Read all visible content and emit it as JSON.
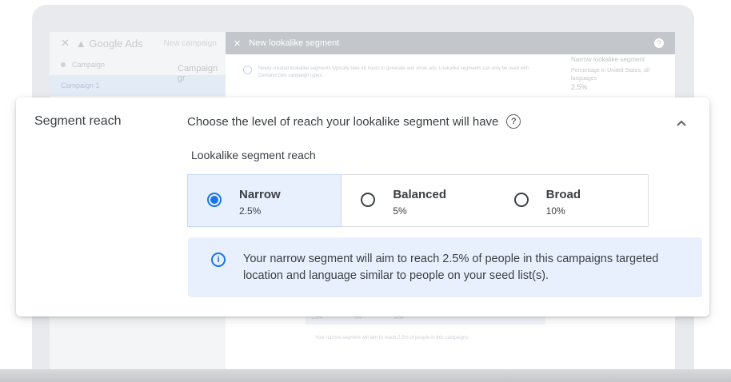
{
  "background": {
    "app_name": "Google Ads",
    "new_campaign": "New campaign",
    "sidebar": {
      "campaign_label": "Campaign",
      "campaign_item": "Campaign 1",
      "mid_label": "Campaign gr"
    },
    "panel": {
      "title": "New lookalike segment",
      "notice": "Newly created lookalike segments typically take 48 hours to generate and show ads. Lookalike segments can only be used with Demand Gen campaign types.",
      "side_title": "Narrow lookalike segment",
      "side_desc": "Percentage in United States, all languages",
      "side_value": "2.5%",
      "bottom_opt1": "2.5%",
      "bottom_opt2": "5%",
      "bottom_opt3": "10%",
      "bottom_msg": "Your narrow segment will aim to reach 2.5% of people in this campaigns"
    }
  },
  "card": {
    "section_title": "Segment reach",
    "description": "Choose the level of reach your lookalike segment will have",
    "subheading": "Lookalike segment reach",
    "options": [
      {
        "label": "Narrow",
        "value": "2.5%",
        "selected": true
      },
      {
        "label": "Balanced",
        "value": "5%",
        "selected": false
      },
      {
        "label": "Broad",
        "value": "10%",
        "selected": false
      }
    ],
    "info_text": "Your narrow segment will aim to reach 2.5% of people in this campaigns targeted location and language similar to people on your seed list(s)."
  },
  "colors": {
    "accent": "#1a73e8",
    "selected_bg": "#e8f0fe"
  },
  "icons": {
    "help": "help-circle-icon",
    "collapse": "chevron-up-icon",
    "info": "info-icon"
  }
}
